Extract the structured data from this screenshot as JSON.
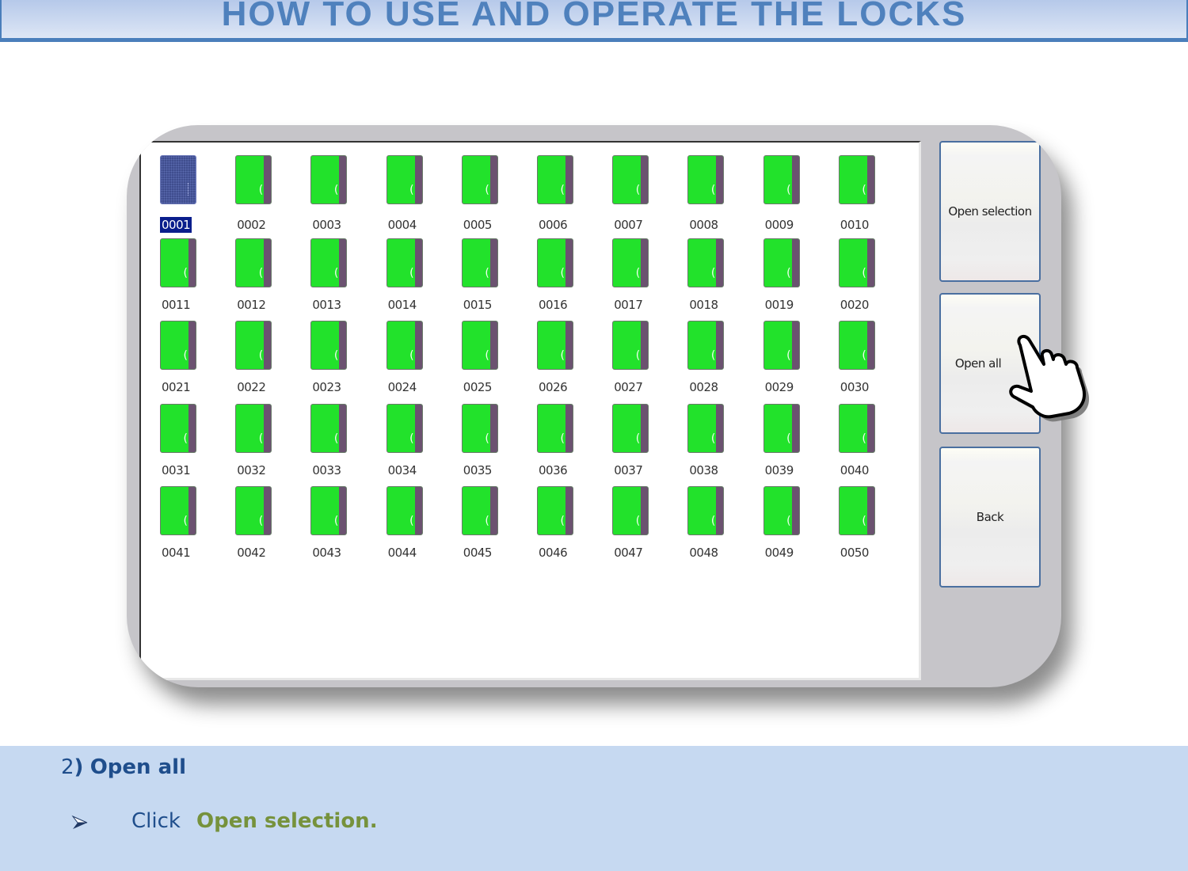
{
  "header": {
    "title": "HOW TO USE  AND OPERATE THE LOCKS"
  },
  "lock_panel": {
    "selected": "0001",
    "locks": [
      "0001",
      "0002",
      "0003",
      "0004",
      "0005",
      "0006",
      "0007",
      "0008",
      "0009",
      "0010",
      "0011",
      "0012",
      "0013",
      "0014",
      "0015",
      "0016",
      "0017",
      "0018",
      "0019",
      "0020",
      "0021",
      "0022",
      "0023",
      "0024",
      "0025",
      "0026",
      "0027",
      "0028",
      "0029",
      "0030",
      "0031",
      "0032",
      "0033",
      "0034",
      "0035",
      "0036",
      "0037",
      "0038",
      "0039",
      "0040",
      "0041",
      "0042",
      "0043",
      "0044",
      "0045",
      "0046",
      "0047",
      "0048",
      "0049",
      "0050"
    ],
    "colors": {
      "closed_door": "#22e22b",
      "door_edge": "#6b5270",
      "selected_door": "#3f4d8e",
      "selected_label_bg": "#0a1e8c"
    }
  },
  "buttons": {
    "open_selection": "Open selection",
    "open_all": "Open all",
    "back": "Back"
  },
  "pointer": {
    "icon": "hand-pointer-icon",
    "target": "Open all"
  },
  "instructions": {
    "step_number": "2",
    "step_paren": ")",
    "step_title": "Open all",
    "bullet_icon": "arrowhead-bullet-icon",
    "action_verb": "Click",
    "action_target": "Open selection."
  }
}
